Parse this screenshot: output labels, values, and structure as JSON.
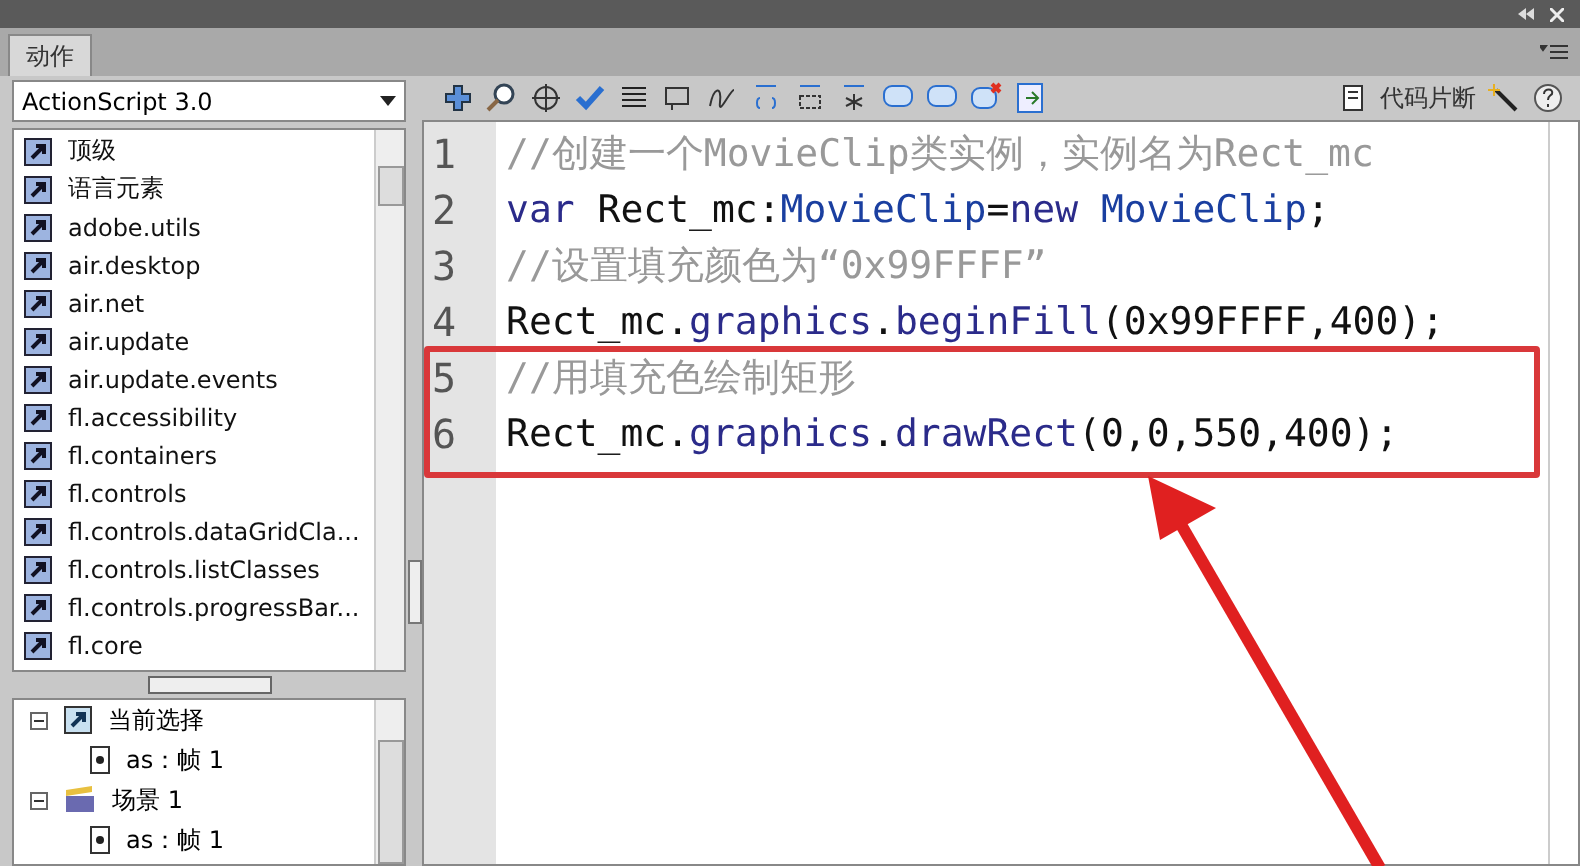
{
  "panel": {
    "tab": {
      "label": "动作",
      "selected": true
    }
  },
  "version_select": {
    "value": "ActionScript 3.0"
  },
  "package_list": [
    "顶级",
    "语言元素",
    "adobe.utils",
    "air.desktop",
    "air.net",
    "air.update",
    "air.update.events",
    "fl.accessibility",
    "fl.containers",
    "fl.controls",
    "fl.controls.dataGridCla...",
    "fl.controls.listClasses",
    "fl.controls.progressBar...",
    "fl.core"
  ],
  "script_tree": [
    {
      "label": "当前选择",
      "kind": "selection",
      "expanded": true,
      "children": [
        {
          "label": "as：帧 1",
          "kind": "frame"
        }
      ]
    },
    {
      "label": "场景 1",
      "kind": "scene",
      "expanded": true,
      "children": [
        {
          "label": "as：帧 1",
          "kind": "frame"
        }
      ]
    }
  ],
  "toolbar": {
    "snippets_label": "代码片断"
  },
  "code_lines": [
    {
      "number": "1",
      "tokens": [
        {
          "kind": "comment",
          "text": "//创建一个MovieClip类实例，实例名为Rect_mc"
        }
      ]
    },
    {
      "number": "2",
      "tokens": [
        {
          "kind": "keyword",
          "text": "var"
        },
        {
          "kind": "plain",
          "text": " Rect_mc:"
        },
        {
          "kind": "type",
          "text": "MovieClip"
        },
        {
          "kind": "plain",
          "text": "="
        },
        {
          "kind": "keyword",
          "text": "new"
        },
        {
          "kind": "type",
          "text": " MovieClip"
        },
        {
          "kind": "plain",
          "text": ";"
        }
      ]
    },
    {
      "number": "3",
      "tokens": [
        {
          "kind": "comment",
          "text": "//设置填充颜色为“0x99FFFF”"
        }
      ]
    },
    {
      "number": "4",
      "tokens": [
        {
          "kind": "plain",
          "text": "Rect_mc."
        },
        {
          "kind": "method",
          "text": "graphics"
        },
        {
          "kind": "plain",
          "text": "."
        },
        {
          "kind": "method",
          "text": "beginFill"
        },
        {
          "kind": "plain",
          "text": "(0x99FFFF,400);"
        }
      ]
    },
    {
      "number": "5",
      "highlighted": true,
      "tokens": [
        {
          "kind": "comment",
          "text": "//用填充色绘制矩形"
        }
      ]
    },
    {
      "number": "6",
      "highlighted": true,
      "tokens": [
        {
          "kind": "plain",
          "text": "Rect_mc."
        },
        {
          "kind": "method",
          "text": "graphics"
        },
        {
          "kind": "plain",
          "text": "."
        },
        {
          "kind": "method",
          "text": "drawRect"
        },
        {
          "kind": "plain",
          "text": "(0,0,550,400);"
        }
      ]
    }
  ]
}
